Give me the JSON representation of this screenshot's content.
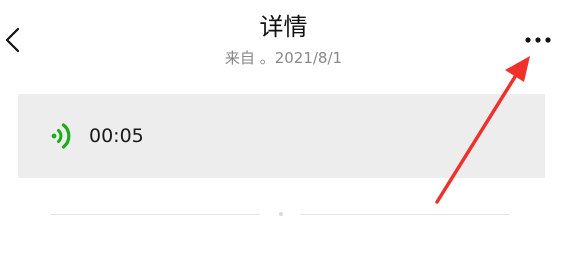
{
  "header": {
    "title": "详情",
    "subtitle": "来自 。2021/8/1",
    "back_icon": "chevron-left-icon",
    "more_icon": "more-horizontal-icon"
  },
  "voice_message": {
    "icon": "voice-wave-icon",
    "duration": "00:05",
    "icon_color": "#1aad19"
  },
  "annotation": {
    "icon": "red-arrow-icon",
    "color": "#f0302b"
  },
  "colors": {
    "card_background": "#ededed",
    "subtitle_text": "#888888"
  }
}
